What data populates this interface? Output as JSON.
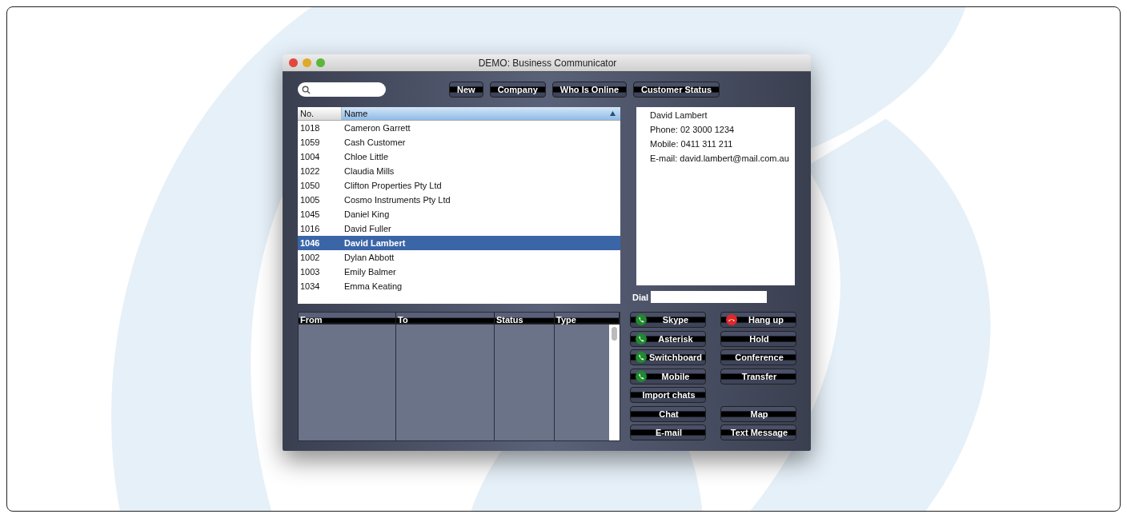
{
  "window": {
    "title": "DEMO: Business Communicator"
  },
  "toolbar_buttons": [
    "New",
    "Company",
    "Who Is Online",
    "Customer Status"
  ],
  "contacts": {
    "columns": [
      {
        "label": "No."
      },
      {
        "label": "Name",
        "sorted": true
      }
    ],
    "rows": [
      {
        "no": "1018",
        "name": "Cameron Garrett",
        "selected": false
      },
      {
        "no": "1059",
        "name": "Cash Customer",
        "selected": false
      },
      {
        "no": "1004",
        "name": "Chloe Little",
        "selected": false
      },
      {
        "no": "1022",
        "name": "Claudia Mills",
        "selected": false
      },
      {
        "no": "1050",
        "name": "Clifton Properties Pty Ltd",
        "selected": false
      },
      {
        "no": "1005",
        "name": "Cosmo Instruments Pty Ltd",
        "selected": false
      },
      {
        "no": "1045",
        "name": "Daniel King",
        "selected": false
      },
      {
        "no": "1016",
        "name": "David Fuller",
        "selected": false
      },
      {
        "no": "1046",
        "name": "David Lambert",
        "selected": true
      },
      {
        "no": "1002",
        "name": "Dylan Abbott",
        "selected": false
      },
      {
        "no": "1003",
        "name": "Emily Balmer",
        "selected": false
      },
      {
        "no": "1034",
        "name": "Emma Keating",
        "selected": false
      }
    ]
  },
  "details": [
    "David Lambert",
    "Phone:  02 3000 1234",
    "Mobile:  0411 311 211",
    "E-mail:  david.lambert@mail.com.au"
  ],
  "dial": {
    "label": "Dial"
  },
  "calls": {
    "columns": [
      "From",
      "To",
      "Status",
      "Type"
    ]
  },
  "action_rows": [
    [
      {
        "label": "Skype",
        "kind": "call"
      },
      {
        "label": "Hang up",
        "kind": "hangup"
      }
    ],
    [
      {
        "label": "Asterisk",
        "kind": "call"
      },
      {
        "label": "Hold",
        "kind": "plain"
      }
    ],
    [
      {
        "label": "Switchboard",
        "kind": "call"
      },
      {
        "label": "Conference",
        "kind": "plain"
      }
    ],
    [
      {
        "label": "Mobile",
        "kind": "call"
      },
      {
        "label": "Transfer",
        "kind": "plain"
      }
    ],
    [
      {
        "label": "Import chats",
        "kind": "plain"
      }
    ],
    [
      {
        "label": "Chat",
        "kind": "plain"
      },
      {
        "label": "Map",
        "kind": "plain"
      }
    ],
    [
      {
        "label": "E-mail",
        "kind": "plain"
      },
      {
        "label": "Text Message",
        "kind": "plain"
      }
    ]
  ]
}
